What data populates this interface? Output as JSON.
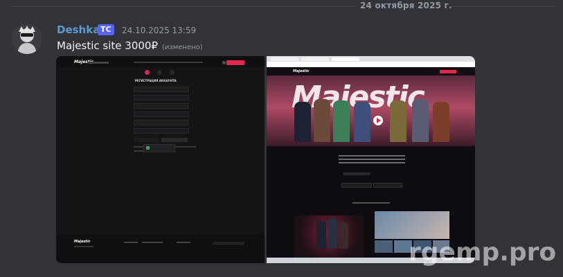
{
  "date_separator": "24 октября 2025 г.",
  "message": {
    "author": "Deshka",
    "badge": "ТС",
    "timestamp": "24.10.2025 13:59",
    "text": "Majestic site  3000₽",
    "edited": "(изменено)"
  },
  "attachments": {
    "left": {
      "brand": "Majestic",
      "form_title": "РЕГИСТРАЦИЯ АККАУНТА",
      "cta": "НАЧАТЬ ИГРАТЬ"
    },
    "right": {
      "brand": "Majestic",
      "hero_title": "Majestic"
    }
  },
  "watermark": "rgemp.pro",
  "colors": {
    "background": "#323339",
    "username": "#5d9ad0",
    "badge": "#5865f2",
    "accent": "#e0284e"
  }
}
